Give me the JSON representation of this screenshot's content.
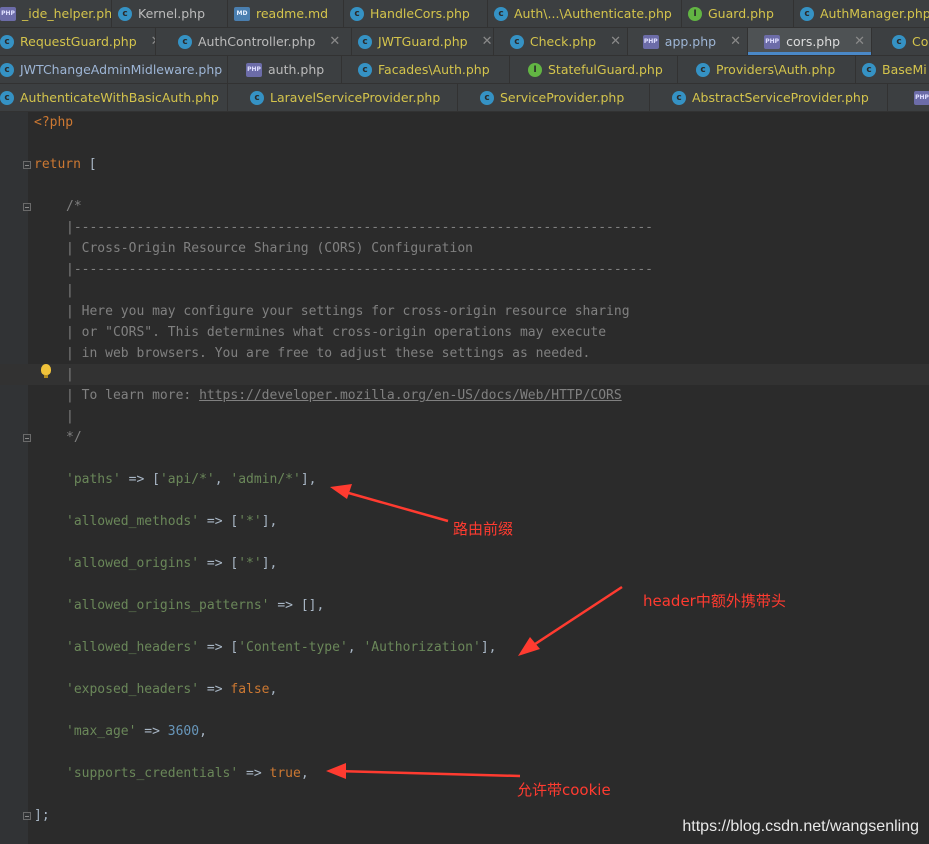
{
  "tabs": {
    "row1": [
      {
        "label": "_ide_helper.php",
        "icon": "php-file-icon",
        "active": false
      },
      {
        "label": "Kernel.php",
        "icon": "class-icon",
        "active": false
      },
      {
        "label": "readme.md",
        "icon": "md-file-icon",
        "active": false
      },
      {
        "label": "HandleCors.php",
        "icon": "class-icon",
        "active": false
      },
      {
        "label": "Auth\\...\\Authenticate.php",
        "icon": "class-icon",
        "active": false
      },
      {
        "label": "Guard.php",
        "icon": "interface-icon",
        "active": false
      },
      {
        "label": "AuthManager.php",
        "icon": "class-icon",
        "active": false
      }
    ],
    "row2": [
      {
        "label": "RequestGuard.php",
        "icon": "class-icon",
        "active": false
      },
      {
        "label": "AuthController.php",
        "icon": "class-icon",
        "active": false
      },
      {
        "label": "JWTGuard.php",
        "icon": "class-icon",
        "active": false
      },
      {
        "label": "Check.php",
        "icon": "class-icon",
        "active": false
      },
      {
        "label": "app.php",
        "icon": "php-file-icon",
        "active": false
      },
      {
        "label": "cors.php",
        "icon": "php-file-icon",
        "active": true
      },
      {
        "label": "Co",
        "icon": "class-icon",
        "active": false
      }
    ],
    "row3": [
      {
        "label": "JWTChangeAdminMidleware.php",
        "icon": "class-icon",
        "active": false
      },
      {
        "label": "auth.php",
        "icon": "php-file-icon",
        "active": false
      },
      {
        "label": "Facades\\Auth.php",
        "icon": "class-icon",
        "active": false
      },
      {
        "label": "StatefulGuard.php",
        "icon": "interface-icon",
        "active": false
      },
      {
        "label": "Providers\\Auth.php",
        "icon": "class-icon",
        "active": false
      },
      {
        "label": "BaseMi",
        "icon": "class-icon",
        "active": false
      }
    ],
    "row4": [
      {
        "label": "AuthenticateWithBasicAuth.php",
        "icon": "class-icon",
        "active": false
      },
      {
        "label": "LaravelServiceProvider.php",
        "icon": "class-icon",
        "active": false
      },
      {
        "label": "ServiceProvider.php",
        "icon": "class-icon",
        "active": false
      },
      {
        "label": "AbstractServiceProvider.php",
        "icon": "class-icon",
        "active": false
      },
      {
        "label": "",
        "icon": "php-file-icon",
        "active": false
      }
    ]
  },
  "code": {
    "php_open": "<?php",
    "return_kw": "return",
    "return_bracket": " [",
    "comment_start": "/*",
    "comment_rule": "|--------------------------------------------------------------------------",
    "comment_title": "| Cross-Origin Resource Sharing (CORS) Configuration",
    "comment_bar": "|",
    "comment_body1": "| Here you may configure your settings for cross-origin resource sharing",
    "comment_body2": "| or \"CORS\". This determines what cross-origin operations may execute",
    "comment_body3": "| in web browsers. You are free to adjust these settings as needed.",
    "learn_more_prefix": "| To learn more: ",
    "learn_more_url": "https://developer.mozilla.org/en-US/docs/Web/HTTP/CORS",
    "comment_end": "*/",
    "paths": {
      "key": "'paths'",
      "op": " => ",
      "open": "[",
      "v1": "'api/*'",
      "sep": ", ",
      "v2": "'admin/*'",
      "close": "],"
    },
    "allowed_methods": {
      "key": "'allowed_methods'",
      "op": " => ",
      "open": "[",
      "v1": "'*'",
      "close": "],"
    },
    "allowed_origins": {
      "key": "'allowed_origins'",
      "op": " => ",
      "open": "[",
      "v1": "'*'",
      "close": "],"
    },
    "allowed_origins_patterns": {
      "key": "'allowed_origins_patterns'",
      "op": " => ",
      "rest": "[],"
    },
    "allowed_headers": {
      "key": "'allowed_headers'",
      "op": " => ",
      "open": "[",
      "v1": "'Content-type'",
      "sep": ", ",
      "v2": "'Authorization'",
      "close": "],"
    },
    "exposed_headers": {
      "key": "'exposed_headers'",
      "op": " => ",
      "val": "false",
      "comma": ","
    },
    "max_age": {
      "key": "'max_age'",
      "op": " => ",
      "val": "3600",
      "comma": ","
    },
    "supports_credentials": {
      "key": "'supports_credentials'",
      "op": " => ",
      "val": "true",
      "comma": ","
    },
    "closing": "];"
  },
  "annotations": {
    "paths_note": "路由前缀",
    "headers_note": "header中额外携带头",
    "credentials_note": "允许带cookie",
    "color": "#ff3b30"
  },
  "watermark": "https://blog.csdn.net/wangsenling"
}
